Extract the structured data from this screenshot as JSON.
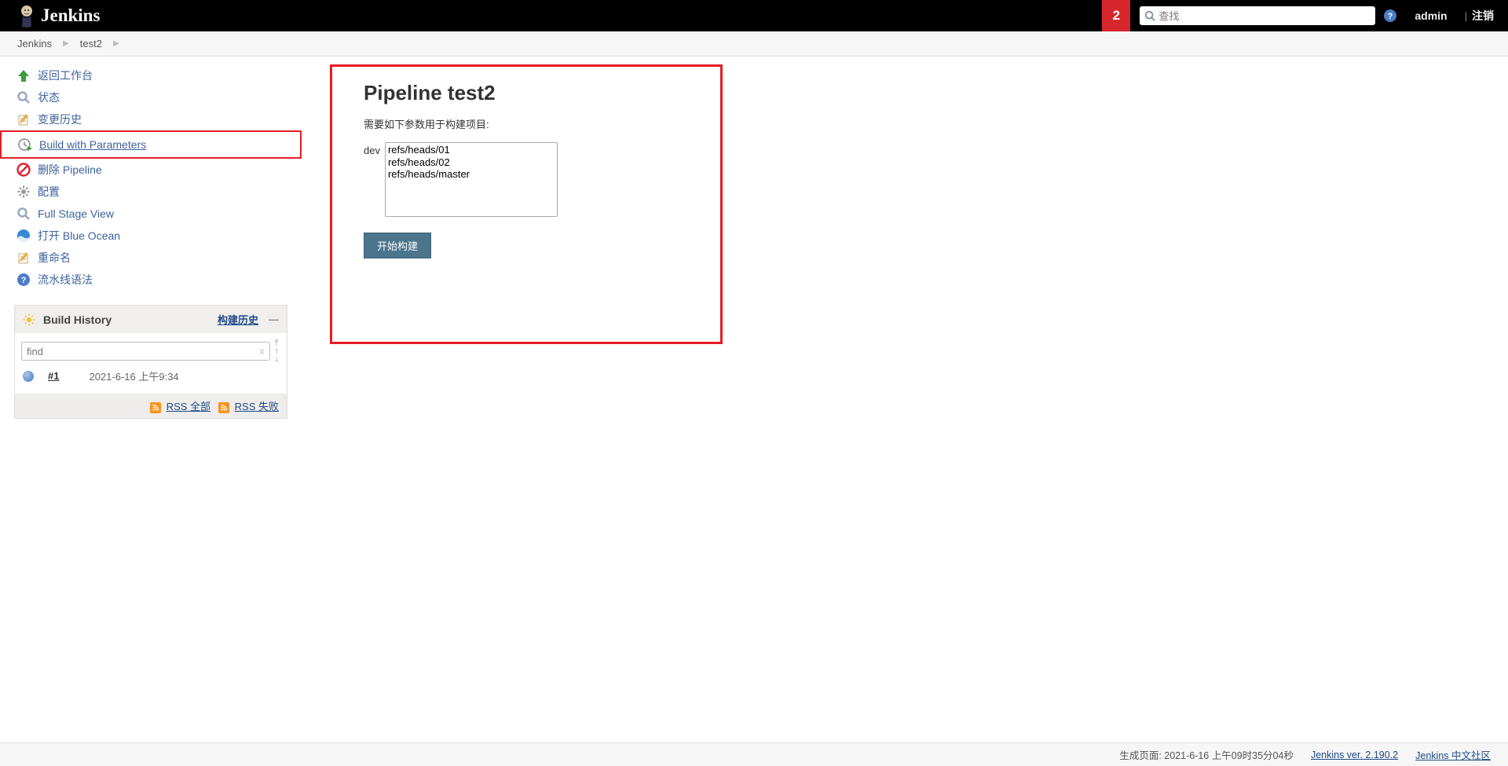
{
  "header": {
    "logo_text": "Jenkins",
    "badge_count": "2",
    "search_placeholder": "查找",
    "user_label": "admin",
    "logout_label": "注销"
  },
  "breadcrumb": {
    "items": [
      "Jenkins",
      "test2"
    ]
  },
  "sidebar": {
    "tasks": [
      {
        "label": "返回工作台"
      },
      {
        "label": "状态"
      },
      {
        "label": "变更历史"
      },
      {
        "label": "Build with Parameters"
      },
      {
        "label": "删除 Pipeline"
      },
      {
        "label": "配置"
      },
      {
        "label": "Full Stage View"
      },
      {
        "label": "打开 Blue Ocean"
      },
      {
        "label": "重命名"
      },
      {
        "label": "流水线语法"
      }
    ]
  },
  "build_history": {
    "title": "Build History",
    "trend_label": "构建历史",
    "find_placeholder": "find",
    "items": [
      {
        "num": "#1",
        "time": "2021-6-16 上午9:34"
      }
    ],
    "rss_all": "RSS 全部",
    "rss_fail": "RSS 失败"
  },
  "main": {
    "title": "Pipeline test2",
    "need_params_text": "需要如下参数用于构建项目:",
    "param_name": "dev",
    "options": [
      "refs/heads/01",
      "refs/heads/02",
      "refs/heads/master"
    ],
    "build_button": "开始构建"
  },
  "footer": {
    "gen_text": "生成页面: 2021-6-16 上午09时35分04秒",
    "version_label": "Jenkins ver. 2.190.2",
    "community_label": "Jenkins 中文社区"
  }
}
